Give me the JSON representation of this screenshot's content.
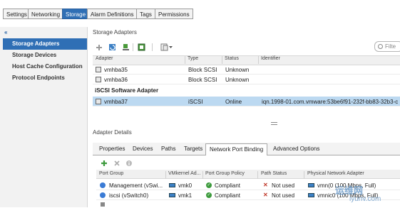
{
  "top_tabs": [
    {
      "label": "Settings",
      "active": false
    },
    {
      "label": "Networking",
      "active": false
    },
    {
      "label": "Storage",
      "active": true
    },
    {
      "label": "Alarm Definitions",
      "active": false
    },
    {
      "label": "Tags",
      "active": false
    },
    {
      "label": "Permissions",
      "active": false
    }
  ],
  "sidebar": {
    "collapse_glyph": "«",
    "items": [
      {
        "label": "Storage Adapters",
        "active": true
      },
      {
        "label": "Storage Devices",
        "active": false
      },
      {
        "label": "Host Cache Configuration",
        "active": false
      },
      {
        "label": "Protocol Endpoints",
        "active": false
      }
    ]
  },
  "storage_adapters": {
    "title": "Storage Adapters",
    "filter_placeholder": "Filte",
    "toolbar_icons": [
      "add-icon",
      "rescan-icon",
      "rescan-vmfs-icon",
      "refresh-icon",
      "actions-menu-icon"
    ],
    "columns": [
      "Adapter",
      "Type",
      "Status",
      "Identifier"
    ],
    "rows": [
      {
        "adapter": "vmhba35",
        "type": "Block SCSI",
        "status": "Unknown",
        "identifier": "",
        "selected": false
      },
      {
        "adapter": "vmhba36",
        "type": "Block SCSI",
        "status": "Unknown",
        "identifier": "",
        "selected": false
      }
    ],
    "group_label": "iSCSI Software Adapter",
    "group_rows": [
      {
        "adapter": "vmhba37",
        "type": "iSCSI",
        "status": "Online",
        "identifier": "iqn.1998-01.com.vmware:53be6f91-232f-bb83-32b3-c",
        "selected": true
      }
    ]
  },
  "adapter_details": {
    "title": "Adapter Details",
    "tabs": [
      {
        "label": "Properties",
        "active": false
      },
      {
        "label": "Devices",
        "active": false
      },
      {
        "label": "Paths",
        "active": false
      },
      {
        "label": "Targets",
        "active": false
      },
      {
        "label": "Network Port Binding",
        "active": true
      },
      {
        "label": "Advanced Options",
        "active": false
      }
    ],
    "columns": [
      "Port Group",
      "VMkernel Ad...",
      "Port Group Policy",
      "Path Status",
      "Physical Network Adapter"
    ],
    "rows": [
      {
        "port_group": "Management (vSwi...",
        "vmk": "vmk0",
        "policy": "Compliant",
        "path_status": "Not used",
        "physical": "vmn(0 (100 Mbps, Full)"
      },
      {
        "port_group": "iscsi (vSwitch0)",
        "vmk": "vmk1",
        "policy": "Compliant",
        "path_status": "Not used",
        "physical": "vmnic0 (100 Mbps, Full)"
      }
    ]
  },
  "watermark": {
    "line1": "运维网",
    "line2": "iyunv.com"
  },
  "colors": {
    "accent": "#2f6fb5",
    "selected_row": "#bcd9f1",
    "ok": "#3c9a3c",
    "error": "#c0392b"
  }
}
